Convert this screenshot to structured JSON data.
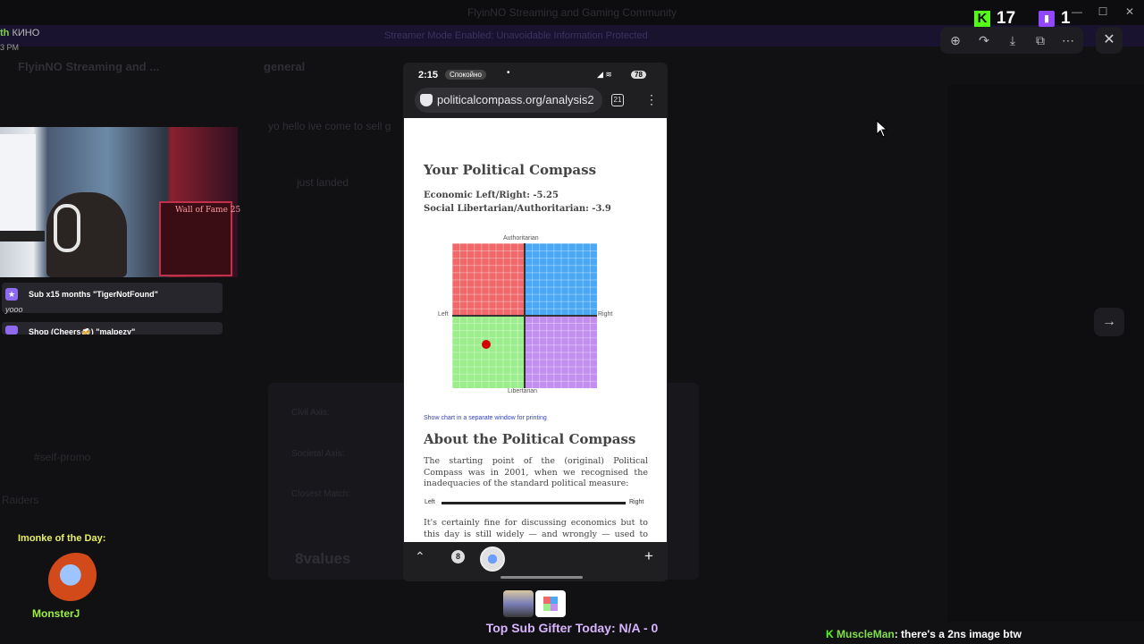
{
  "background_app": {
    "window_title": "FlyinNO Streaming and Gaming Community",
    "banner_text": "Streamer Mode Enabled: Unavoidable Information Protected",
    "server_name": "FlyinNO Streaming and ...",
    "channel_name": "general",
    "message_1": "yo hello ive come to sell g",
    "message_2": "just landed",
    "sidebar_channels": [
      "#self-promo",
      "Raiders"
    ],
    "modal_title": "8values",
    "modal_rows": [
      "Civil Axis:",
      "Societal Axis:",
      "Closest Match:"
    ]
  },
  "stream_overlay": {
    "badge_prefix": "th",
    "badge_label": "КИНО",
    "time_fragment": "3 PM",
    "webcam_sign": "Wall of Fame 25",
    "alerts": [
      {
        "title": "Sub x15 months \"TigerNotFound\"",
        "sub": "yooo"
      },
      {
        "title": "Shop (Cheers🍻) \"malpezy\"",
        "sub": ""
      }
    ],
    "monke_title": "Imonke of the Day:",
    "monke_name": "MonsterJ",
    "gifter_text": "Top Sub Gifter Today: N/A - 0",
    "chat": {
      "user": "MuscleMan",
      "message": ": there's a 2ns image btw"
    }
  },
  "viewers": {
    "kick": "17",
    "twitch": "1"
  },
  "window_controls": {
    "minimize": "—",
    "maximize": "☐",
    "close": "✕"
  },
  "image_viewer": {
    "toolbar": [
      "zoom-in-icon",
      "share-icon",
      "download-icon",
      "open-external-icon",
      "more-icon"
    ],
    "close_glyph": "✕",
    "next_glyph": "→"
  },
  "phone": {
    "status": {
      "time": "2:15",
      "mode": "Спокойно",
      "dot": "•",
      "battery": "78"
    },
    "url": "politicalcompass.org/analysis2",
    "tabs_count": "8",
    "page": {
      "heading": "Your Political Compass",
      "economic": "Economic Left/Right: -5.25",
      "social": "Social Libertarian/Authoritarian: -3.9",
      "compass": {
        "top": "Authoritarian",
        "bottom": "Libertarian",
        "left": "Left",
        "right": "Right",
        "quadrant_colors": [
          "#f0686a",
          "#4aa8f7",
          "#9bee8b",
          "#c28ef0"
        ],
        "economic_value": -5.25,
        "social_value": -3.9
      },
      "print_link": "Show chart in a separate window for printing",
      "about_heading": "About the Political Compass",
      "about_para": "The starting point of the (original) Political Compass was in 2001, when we recognised the inadequacies of the standard political measure:",
      "scale_left": "Left",
      "scale_right": "Right",
      "para2": "It's certainly fine for discussing economics but to this day is still widely — and wrongly — used to describe social"
    }
  }
}
